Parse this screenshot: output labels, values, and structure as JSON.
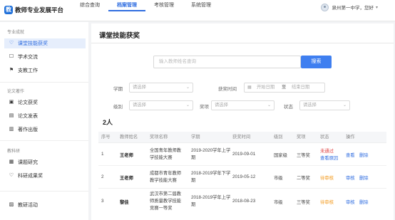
{
  "app": {
    "logo_glyph": "教",
    "title": "教师专业发展平台"
  },
  "nav": [
    {
      "label": "综合查询",
      "active": false
    },
    {
      "label": "档案管理",
      "active": true
    },
    {
      "label": "考核管理",
      "active": false
    },
    {
      "label": "系统管理",
      "active": false
    }
  ],
  "user": {
    "text": "泉州第一中学，您好",
    "icon": "user-avatar-icon"
  },
  "sidebar": {
    "group1": "专业成就",
    "group2": "论文著作",
    "group3": "教科研",
    "items": [
      {
        "label": "课堂技能获奖",
        "icon": "trophy-icon",
        "active": true
      },
      {
        "label": "学术交流",
        "icon": "chat-icon"
      },
      {
        "label": "支教工作",
        "icon": "flag-icon"
      },
      {
        "label": "论文获奖",
        "icon": "award-icon"
      },
      {
        "label": "论文发表",
        "icon": "document-icon"
      },
      {
        "label": "著作出版",
        "icon": "book-icon"
      },
      {
        "label": "课题研究",
        "icon": "research-icon"
      },
      {
        "label": "科研成果奖",
        "icon": "medal-icon"
      },
      {
        "label": "教研活动",
        "icon": "calendar-icon"
      }
    ]
  },
  "main": {
    "title": "课堂技能获奖",
    "search": {
      "placeholder": "输入教师姓名查询",
      "button": "搜索"
    },
    "filters": {
      "subject_label": "学期",
      "subject_value": "请选择",
      "time_label": "获奖时间",
      "start_placeholder": "开始日期",
      "sep": "至",
      "end_placeholder": "结束日期",
      "level_label": "级别",
      "level_value": "请选择",
      "award_label": "奖项",
      "award_value": "请选择",
      "status_label": "状态",
      "status_value": "请选择"
    },
    "count": "2人",
    "columns": [
      "序号",
      "教师姓名",
      "奖项名称",
      "学期",
      "获奖时间",
      "级别",
      "奖项",
      "状态",
      "操作"
    ],
    "rows": [
      {
        "no": "1",
        "name": "王老师",
        "award_name": [
          "全国青年教师教",
          "学技能大赛"
        ],
        "term": "2019-2020学年上学期",
        "date": "2019-09-01",
        "level": "国家级",
        "prize": "三等奖",
        "status": "未通过",
        "status_extra": "查看原因",
        "status_color": "#e04040",
        "ops": [
          "查看",
          "删除"
        ]
      },
      {
        "no": "2",
        "name": "王老师",
        "award_name": [
          "成都市青年教师",
          "教学技能大赛"
        ],
        "term": "2018-2019学年下学期",
        "date": "2019-05-12",
        "level": "市级",
        "prize": "二等奖",
        "status": "待审核",
        "status_extra": "",
        "status_color": "#f39a1e",
        "ops": [
          "审核",
          "删除"
        ]
      },
      {
        "no": "3",
        "name": "黎佳",
        "award_name": [
          "武汉市第二届教",
          "师质量教学技能",
          "竞赛一等奖"
        ],
        "term": "2018-2019学年上学期",
        "date": "2018-08-23",
        "level": "市级",
        "prize": "三等奖",
        "status": "待审核",
        "status_extra": "",
        "status_color": "#f39a1e",
        "ops": [
          "审核",
          "删除"
        ]
      }
    ]
  }
}
